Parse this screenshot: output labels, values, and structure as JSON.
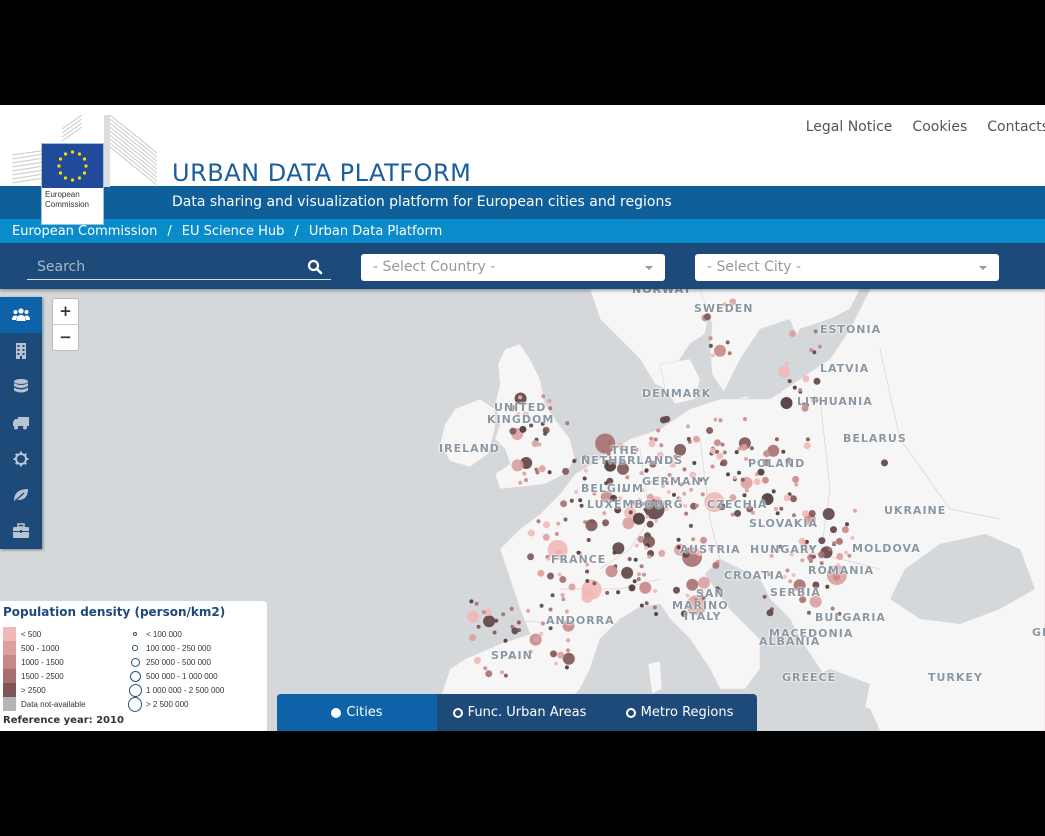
{
  "header": {
    "top_links": [
      "Legal Notice",
      "Cookies",
      "Contacts"
    ],
    "logo_text_line1": "European",
    "logo_text_line2": "Commission",
    "title": "URBAN DATA PLATFORM",
    "subtitle": "Data sharing and visualization platform for European cities and regions"
  },
  "breadcrumb": [
    "European Commission",
    "EU Science Hub",
    "Urban Data Platform"
  ],
  "breadcrumb_separator": "/",
  "toolbar": {
    "search_placeholder": "Search",
    "country_select": "- Select Country -",
    "city_select": "- Select City -"
  },
  "map": {
    "zoom_in": "+",
    "zoom_out": "−",
    "side_menu": [
      {
        "icon": "population-icon",
        "active": true
      },
      {
        "icon": "building-icon",
        "active": false
      },
      {
        "icon": "database-icon",
        "active": false
      },
      {
        "icon": "truck-icon",
        "active": false
      },
      {
        "icon": "gear-icon",
        "active": false
      },
      {
        "icon": "leaf-icon",
        "active": false
      },
      {
        "icon": "briefcase-icon",
        "active": false
      }
    ],
    "country_labels": [
      "NORWAY",
      "SWEDEN",
      "ESTONIA",
      "LATVIA",
      "LITHUANIA",
      "DENMARK",
      "UNITED",
      "KINGDOM",
      "IRELAND",
      "BELARUS",
      "THE",
      "NETHERLANDS",
      "POLAND",
      "GERMANY",
      "BELGIUM",
      "LUXEMBOURG",
      "CZECHIA",
      "UKRAINE",
      "SLOVAKIA",
      "MOLDOVA",
      "FRANCE",
      "AUSTRIA",
      "HUNGARY",
      "ROMANIA",
      "CROATIA",
      "SAN",
      "MARINO",
      "SERBIA",
      "ANDORRA",
      "ITALY",
      "BULGARIA",
      "MACEDONIA",
      "ALBANIA",
      "SPAIN",
      "GREECE",
      "TURKEY",
      "GE"
    ],
    "layer_tabs": [
      {
        "label": "Cities",
        "active": true
      },
      {
        "label": "Func. Urban Areas",
        "active": false
      },
      {
        "label": "Metro Regions",
        "active": false
      }
    ]
  },
  "legend": {
    "title": "Population density (person/km2)",
    "density_classes": [
      {
        "label": "< 500",
        "color": "#f2b8b8"
      },
      {
        "label": "500 - 1000",
        "color": "#dca0a0"
      },
      {
        "label": "1000 - 1500",
        "color": "#c88888"
      },
      {
        "label": "1500 - 2500",
        "color": "#a86f6f"
      },
      {
        "label": "> 2500",
        "color": "#7f5555"
      },
      {
        "label": "Data not-available",
        "color": "#b5b5b5"
      }
    ],
    "size_classes": [
      "< 100 000",
      "100 000 - 250 000",
      "250 000 - 500 000",
      "500 000 - 1 000 000",
      "1 000 000 - 2 500 000",
      "> 2 500 000"
    ],
    "reference_year": "Reference year: 2010"
  },
  "colors": {
    "header_blue": "#0e5f9a",
    "breadcrumb_blue": "#0a8ccb",
    "toolbar_navy": "#1e4a7a",
    "title_blue": "#1a5e9b",
    "sea": "#d4d8da",
    "land": "#f6f6f6"
  }
}
